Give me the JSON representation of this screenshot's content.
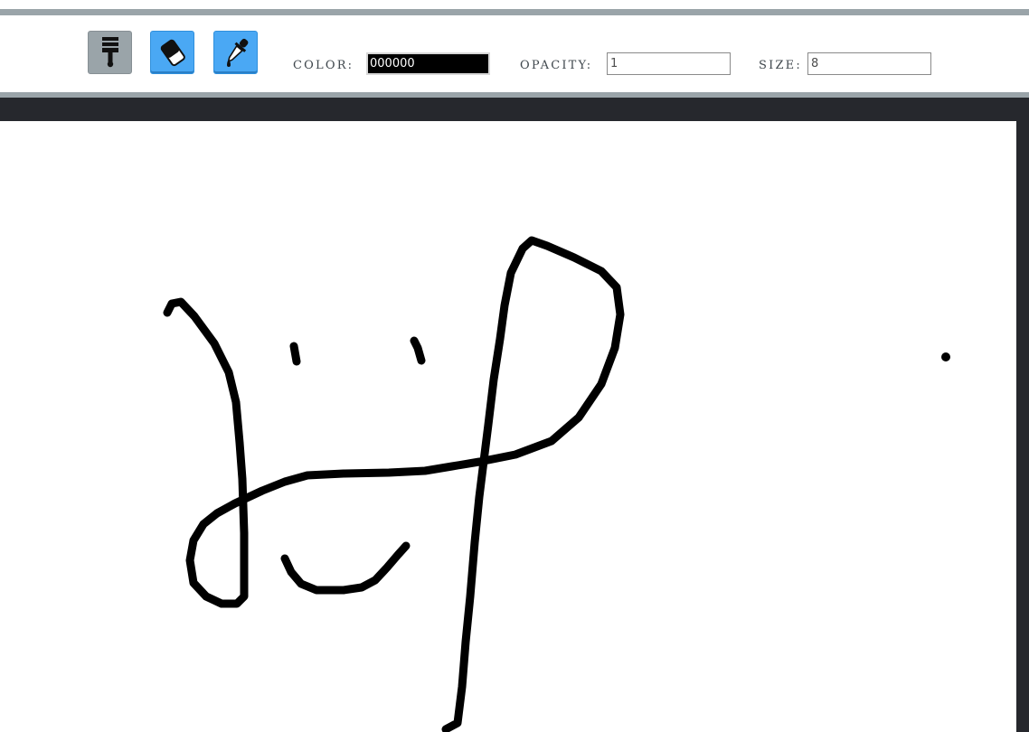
{
  "toolbar": {
    "tools": [
      {
        "name": "brush-icon",
        "state": "active"
      },
      {
        "name": "eraser-icon",
        "state": "idle"
      },
      {
        "name": "eyedropper-icon",
        "state": "idle"
      }
    ],
    "color_label": "COLOR:",
    "color_value": "000000",
    "opacity_label": "OPACITY:",
    "opacity_value": "1",
    "size_label": "SIZE:",
    "size_value": "8"
  },
  "colors": {
    "accent_blue": "#4aa8f4",
    "active_gray": "#9aa4a9",
    "frame_dark": "#26282d",
    "stroke": "#000000"
  }
}
